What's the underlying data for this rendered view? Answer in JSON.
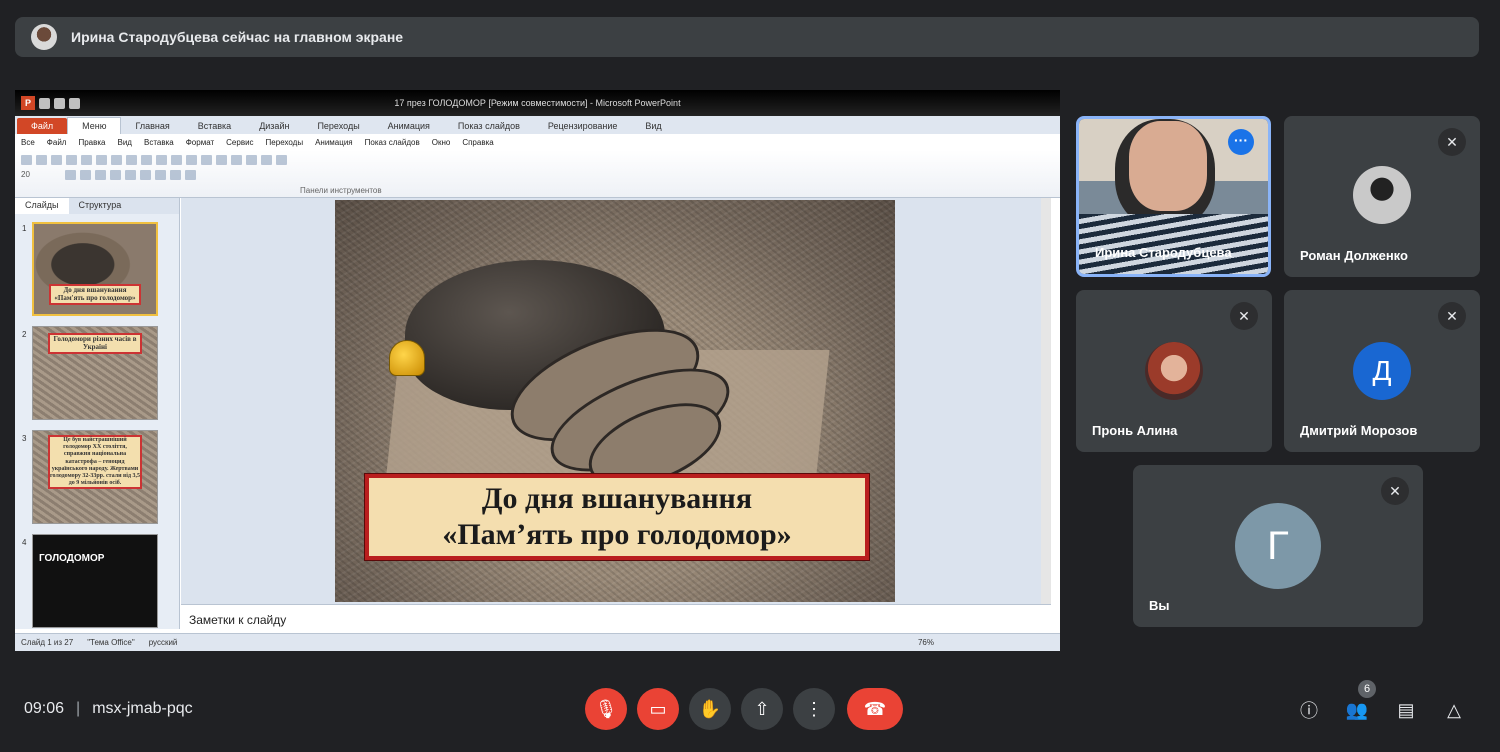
{
  "banner": {
    "text": "Ирина Стародубцева сейчас на главном экране"
  },
  "powerpoint": {
    "window_title": "17 през ГОЛОДОМОР [Режим совместимости] - Microsoft PowerPoint",
    "ribbon_tabs": [
      "Файл",
      "Меню",
      "Главная",
      "Вставка",
      "Дизайн",
      "Переходы",
      "Анимация",
      "Показ слайдов",
      "Рецензирование",
      "Вид"
    ],
    "menu_items": [
      "Все",
      "Файл",
      "Правка",
      "Вид",
      "Вставка",
      "Формат",
      "Сервис",
      "Переходы",
      "Анимация",
      "Показ слайдов",
      "Окно",
      "Справка"
    ],
    "font_size": "20",
    "toolbar_group_label": "Панели инструментов",
    "panel_tabs": [
      "Слайды",
      "Структура"
    ],
    "thumbnails": [
      {
        "num": "1",
        "text": "До дня вшанування «Пам'ять про голодомор»"
      },
      {
        "num": "2",
        "text": "Голодомори різних часів в Україні"
      },
      {
        "num": "3",
        "text": "Це був найстрашніший голодомор XX століття, справжня національна катастрофа – геноцид українського народу. Жертвами голодомору 32-33рр. стали від 3,5 до 9 мільйонів осіб."
      },
      {
        "num": "4",
        "text": "ГОЛОДОМОР"
      }
    ],
    "slide": {
      "line1": "До дня  вшанування",
      "line2": "«Пам’ять про голодомор»"
    },
    "notes_placeholder": "Заметки к слайду",
    "status": {
      "slide_info": "Слайд 1 из 27",
      "theme": "\"Тема Office\"",
      "language": "русский",
      "zoom": "76%"
    }
  },
  "participants": [
    {
      "name": "Ирина Стародубцева",
      "self_camera": true
    },
    {
      "name": "Роман Долженко",
      "muted": true
    },
    {
      "name": "Пронь Алина",
      "muted": true
    },
    {
      "name": "Дмитрий Морозов",
      "muted": true,
      "initial": "Д",
      "color": "#1967d2"
    },
    {
      "name": "Вы",
      "muted": true,
      "initial": "Г",
      "color": "#7d98a8"
    }
  ],
  "bottom_bar": {
    "time": "09:06",
    "meeting_code": "msx-jmab-pqc",
    "participant_count": "6"
  },
  "icons": [
    "mic-off-icon",
    "camera-off-icon",
    "raise-hand-icon",
    "present-icon",
    "more-options-icon",
    "end-call-icon",
    "info-icon",
    "people-icon",
    "chat-icon",
    "activities-icon"
  ],
  "colors": {
    "background": "#202124",
    "tile": "#3c4043",
    "danger": "#ea4335",
    "accent": "#8ab4f8"
  }
}
